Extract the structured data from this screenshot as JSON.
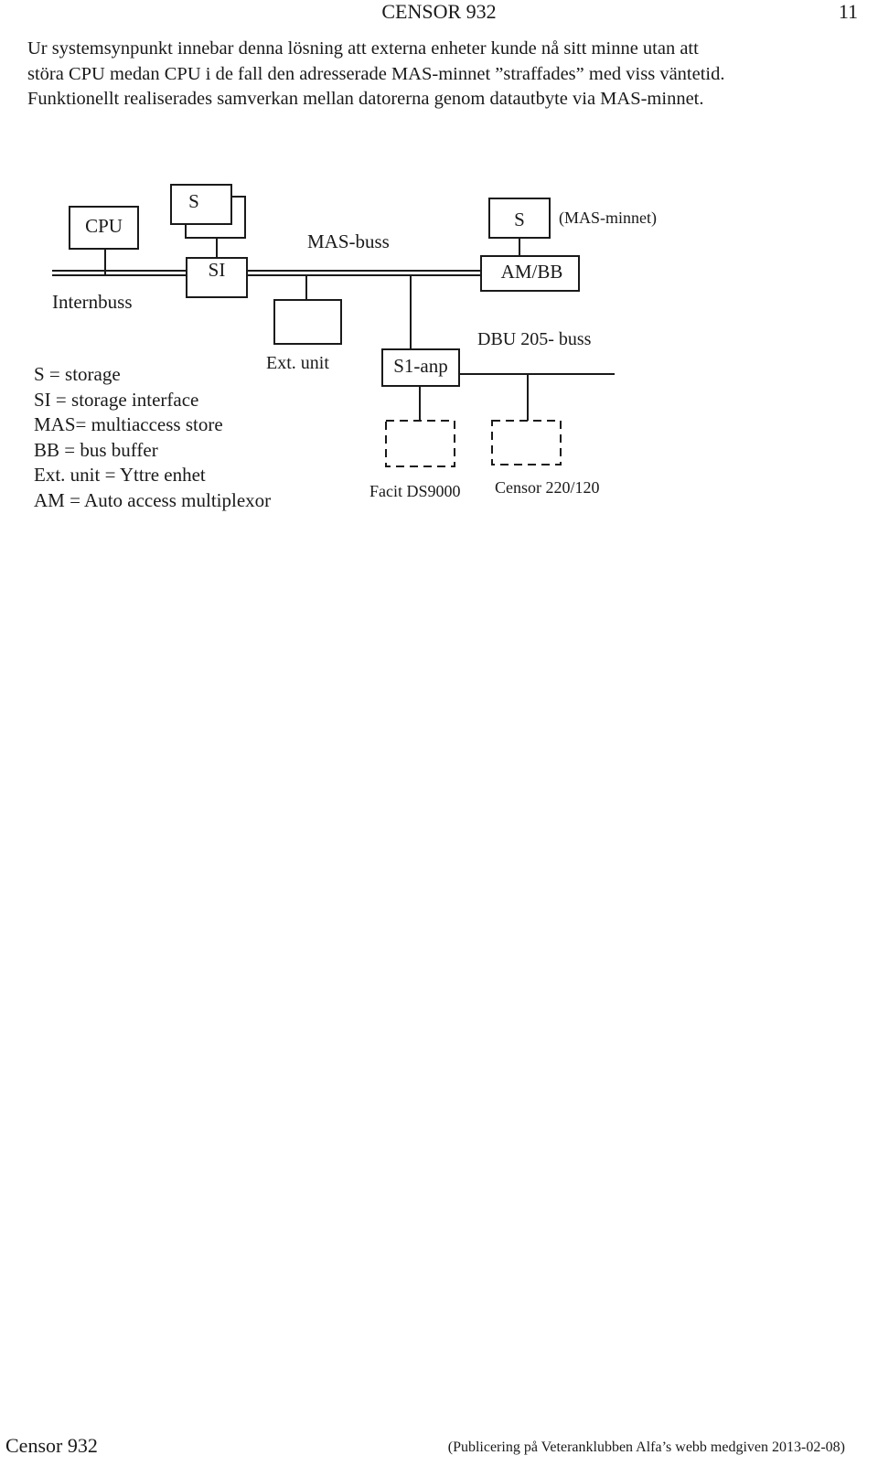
{
  "header": {
    "title": "CENSOR 932",
    "page_number": "11"
  },
  "paragraph": {
    "lines": [
      "Ur systemsynpunkt innebar denna lösning att externa enheter kunde nå sitt minne utan att",
      "störa CPU medan CPU i de fall den adresserade MAS-minnet ”straffades” med viss väntetid.",
      "Funktionellt realiserades samverkan mellan datorerna genom datautbyte via MAS-minnet."
    ]
  },
  "diagram": {
    "boxes": {
      "cpu": "CPU",
      "storage_left": "S",
      "storage_interface": "SI",
      "storage_mas": "S",
      "am_bb": "AM/BB",
      "ext_unit": "",
      "s1_anp": "S1-anp",
      "facit": "",
      "censor": ""
    },
    "labels": {
      "internbuss": "Internbuss",
      "mas_buss": "MAS-buss",
      "mas_minnet": "(MAS-minnet)",
      "ext_unit": "Ext. unit",
      "dbu_buss": "DBU 205- buss",
      "facit": "Facit DS9000",
      "censor": "Censor 220/120"
    },
    "legend": [
      "S = storage",
      "SI = storage interface",
      "MAS= multiaccess store",
      "BB = bus buffer",
      "Ext. unit = Yttre enhet",
      "AM = Auto access multiplexor"
    ]
  },
  "footer": {
    "left": "Censor 932",
    "right": "(Publicering på Veteranklubben Alfa’s webb medgiven 2013-02-08)"
  }
}
